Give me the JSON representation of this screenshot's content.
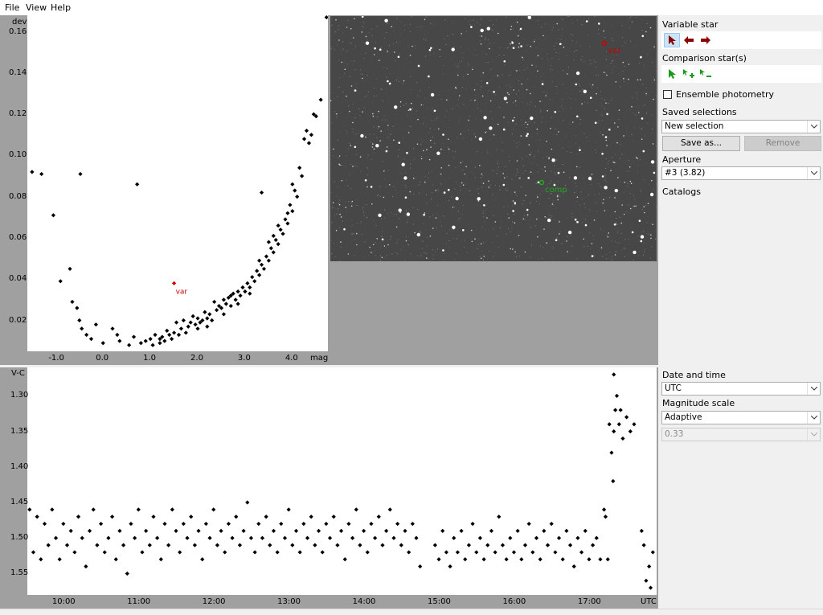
{
  "menu": {
    "file": "File",
    "view": "View",
    "help": "Help"
  },
  "scatter": {
    "ylabel": "dev",
    "xlabel": "mag",
    "yticks": [
      "0.16",
      "0.14",
      "0.12",
      "0.10",
      "0.08",
      "0.06",
      "0.04",
      "0.02"
    ],
    "xticks": [
      "-1.0",
      "0.0",
      "1.0",
      "2.0",
      "3.0",
      "4.0"
    ],
    "var_label": "var"
  },
  "image": {
    "var_label": "var",
    "comp_label": "comp"
  },
  "lightcurve": {
    "ylabel": "V-C",
    "xlabel": "UTC",
    "yticks": [
      "1.30",
      "1.35",
      "1.40",
      "1.45",
      "1.50",
      "1.55"
    ],
    "xticks": [
      "10:00",
      "11:00",
      "12:00",
      "13:00",
      "14:00",
      "15:00",
      "16:00",
      "17:00"
    ]
  },
  "sidebar_top": {
    "variable_star": "Variable star",
    "comparison_stars": "Comparison star(s)",
    "ensemble": "Ensemble photometry",
    "saved_selections": "Saved selections",
    "saved_value": "New selection",
    "save_as": "Save as...",
    "remove": "Remove",
    "aperture": "Aperture",
    "aperture_value": "#3 (3.82)",
    "catalogs": "Catalogs"
  },
  "sidebar_bottom": {
    "date_time": "Date and time",
    "date_time_value": "UTC",
    "mag_scale": "Magnitude scale",
    "mag_scale_value": "Adaptive",
    "scale_value": "0.33"
  },
  "colors": {
    "var": "#cc0000",
    "comp": "#22aa22",
    "arrow_red": "#8b0000",
    "arrow_green": "#1a9a1a"
  },
  "chart_data": [
    {
      "type": "scatter",
      "ylabel": "dev",
      "xlabel": "mag",
      "xlim": [
        -1.6,
        4.75
      ],
      "ylim": [
        0.005,
        0.168
      ],
      "highlight": {
        "name": "var",
        "x": 1.5,
        "y": 0.038
      },
      "points": [
        [
          -1.5,
          0.092
        ],
        [
          -1.3,
          0.091
        ],
        [
          -1.05,
          0.071
        ],
        [
          -0.9,
          0.039
        ],
        [
          -0.7,
          0.045
        ],
        [
          -0.65,
          0.029
        ],
        [
          -0.55,
          0.026
        ],
        [
          -0.5,
          0.02
        ],
        [
          -0.48,
          0.091
        ],
        [
          -0.45,
          0.016
        ],
        [
          -0.35,
          0.013
        ],
        [
          -0.25,
          0.011
        ],
        [
          -0.15,
          0.018
        ],
        [
          0.0,
          0.009
        ],
        [
          0.2,
          0.016
        ],
        [
          0.3,
          0.013
        ],
        [
          0.35,
          0.01
        ],
        [
          0.55,
          0.008
        ],
        [
          0.65,
          0.012
        ],
        [
          0.72,
          0.086
        ],
        [
          0.8,
          0.009
        ],
        [
          0.9,
          0.01
        ],
        [
          1.0,
          0.011
        ],
        [
          1.05,
          0.008
        ],
        [
          1.1,
          0.013
        ],
        [
          1.2,
          0.011
        ],
        [
          1.25,
          0.012
        ],
        [
          1.3,
          0.01
        ],
        [
          1.35,
          0.015
        ],
        [
          1.4,
          0.013
        ],
        [
          1.45,
          0.011
        ],
        [
          1.55,
          0.019
        ],
        [
          1.6,
          0.013
        ],
        [
          1.65,
          0.016
        ],
        [
          1.7,
          0.02
        ],
        [
          1.75,
          0.014
        ],
        [
          1.8,
          0.017
        ],
        [
          1.85,
          0.019
        ],
        [
          1.9,
          0.022
        ],
        [
          1.95,
          0.018
        ],
        [
          2.0,
          0.021
        ],
        [
          2.05,
          0.019
        ],
        [
          2.1,
          0.02
        ],
        [
          2.15,
          0.024
        ],
        [
          2.2,
          0.021
        ],
        [
          2.25,
          0.023
        ],
        [
          2.3,
          0.02
        ],
        [
          2.35,
          0.029
        ],
        [
          2.4,
          0.025
        ],
        [
          2.45,
          0.027
        ],
        [
          2.5,
          0.026
        ],
        [
          2.55,
          0.03
        ],
        [
          2.6,
          0.028
        ],
        [
          2.65,
          0.031
        ],
        [
          2.7,
          0.027
        ],
        [
          2.75,
          0.033
        ],
        [
          2.8,
          0.03
        ],
        [
          2.85,
          0.034
        ],
        [
          2.9,
          0.032
        ],
        [
          2.95,
          0.036
        ],
        [
          3.0,
          0.034
        ],
        [
          3.05,
          0.038
        ],
        [
          3.1,
          0.036
        ],
        [
          3.15,
          0.041
        ],
        [
          3.2,
          0.039
        ],
        [
          3.25,
          0.044
        ],
        [
          3.3,
          0.042
        ],
        [
          3.35,
          0.047
        ],
        [
          3.4,
          0.045
        ],
        [
          3.45,
          0.051
        ],
        [
          3.5,
          0.049
        ],
        [
          3.55,
          0.055
        ],
        [
          3.6,
          0.053
        ],
        [
          3.65,
          0.059
        ],
        [
          3.7,
          0.057
        ],
        [
          3.75,
          0.064
        ],
        [
          3.8,
          0.062
        ],
        [
          3.85,
          0.069
        ],
        [
          3.9,
          0.067
        ],
        [
          3.95,
          0.076
        ],
        [
          4.0,
          0.073
        ],
        [
          4.05,
          0.083
        ],
        [
          4.1,
          0.08
        ],
        [
          4.15,
          0.094
        ],
        [
          4.2,
          0.09
        ],
        [
          4.25,
          0.108
        ],
        [
          4.3,
          0.112
        ],
        [
          4.35,
          0.106
        ],
        [
          4.4,
          0.11
        ],
        [
          4.45,
          0.12
        ],
        [
          4.5,
          0.119
        ],
        [
          3.35,
          0.082
        ],
        [
          4.6,
          0.127
        ],
        [
          4.72,
          0.167
        ],
        [
          2.85,
          0.028
        ],
        [
          3.1,
          0.033
        ],
        [
          3.6,
          0.061
        ],
        [
          3.9,
          0.072
        ],
        [
          2.2,
          0.017
        ],
        [
          1.5,
          0.014
        ],
        [
          2.7,
          0.032
        ],
        [
          3.3,
          0.049
        ],
        [
          4.0,
          0.086
        ],
        [
          3.7,
          0.066
        ],
        [
          3.5,
          0.058
        ],
        [
          2.55,
          0.023
        ],
        [
          2.0,
          0.016
        ],
        [
          1.2,
          0.009
        ]
      ]
    },
    {
      "type": "scatter",
      "ylabel": "V-C",
      "xlabel": "UTC",
      "xlim_hours": [
        9.52,
        17.9
      ],
      "ylim": [
        1.58,
        1.26
      ],
      "points_hours": [
        [
          9.55,
          1.46
        ],
        [
          9.6,
          1.52
        ],
        [
          9.65,
          1.47
        ],
        [
          9.7,
          1.53
        ],
        [
          9.75,
          1.48
        ],
        [
          9.8,
          1.51
        ],
        [
          9.85,
          1.46
        ],
        [
          9.9,
          1.5
        ],
        [
          9.95,
          1.53
        ],
        [
          10.0,
          1.48
        ],
        [
          10.05,
          1.51
        ],
        [
          10.1,
          1.49
        ],
        [
          10.15,
          1.52
        ],
        [
          10.2,
          1.47
        ],
        [
          10.25,
          1.5
        ],
        [
          10.3,
          1.54
        ],
        [
          10.35,
          1.49
        ],
        [
          10.4,
          1.46
        ],
        [
          10.45,
          1.51
        ],
        [
          10.5,
          1.48
        ],
        [
          10.55,
          1.52
        ],
        [
          10.6,
          1.5
        ],
        [
          10.65,
          1.47
        ],
        [
          10.7,
          1.53
        ],
        [
          10.75,
          1.49
        ],
        [
          10.8,
          1.51
        ],
        [
          10.85,
          1.55
        ],
        [
          10.9,
          1.48
        ],
        [
          10.95,
          1.5
        ],
        [
          11.0,
          1.46
        ],
        [
          11.05,
          1.52
        ],
        [
          11.1,
          1.49
        ],
        [
          11.15,
          1.51
        ],
        [
          11.2,
          1.47
        ],
        [
          11.25,
          1.5
        ],
        [
          11.3,
          1.53
        ],
        [
          11.35,
          1.48
        ],
        [
          11.4,
          1.51
        ],
        [
          11.45,
          1.46
        ],
        [
          11.5,
          1.49
        ],
        [
          11.55,
          1.52
        ],
        [
          11.6,
          1.48
        ],
        [
          11.65,
          1.5
        ],
        [
          11.7,
          1.47
        ],
        [
          11.75,
          1.51
        ],
        [
          11.8,
          1.49
        ],
        [
          11.85,
          1.53
        ],
        [
          11.9,
          1.48
        ],
        [
          11.95,
          1.5
        ],
        [
          12.0,
          1.46
        ],
        [
          12.05,
          1.51
        ],
        [
          12.1,
          1.49
        ],
        [
          12.15,
          1.52
        ],
        [
          12.2,
          1.48
        ],
        [
          12.25,
          1.5
        ],
        [
          12.3,
          1.47
        ],
        [
          12.35,
          1.51
        ],
        [
          12.4,
          1.49
        ],
        [
          12.45,
          1.45
        ],
        [
          12.5,
          1.5
        ],
        [
          12.55,
          1.52
        ],
        [
          12.6,
          1.48
        ],
        [
          12.65,
          1.5
        ],
        [
          12.7,
          1.47
        ],
        [
          12.75,
          1.51
        ],
        [
          12.8,
          1.49
        ],
        [
          12.85,
          1.52
        ],
        [
          12.9,
          1.48
        ],
        [
          12.95,
          1.5
        ],
        [
          13.0,
          1.46
        ],
        [
          13.05,
          1.51
        ],
        [
          13.1,
          1.49
        ],
        [
          13.15,
          1.52
        ],
        [
          13.2,
          1.48
        ],
        [
          13.25,
          1.5
        ],
        [
          13.3,
          1.47
        ],
        [
          13.35,
          1.51
        ],
        [
          13.4,
          1.49
        ],
        [
          13.45,
          1.52
        ],
        [
          13.5,
          1.48
        ],
        [
          13.55,
          1.5
        ],
        [
          13.6,
          1.47
        ],
        [
          13.65,
          1.51
        ],
        [
          13.7,
          1.49
        ],
        [
          13.75,
          1.53
        ],
        [
          13.8,
          1.48
        ],
        [
          13.85,
          1.5
        ],
        [
          13.9,
          1.46
        ],
        [
          13.95,
          1.51
        ],
        [
          14.0,
          1.49
        ],
        [
          14.05,
          1.52
        ],
        [
          14.1,
          1.48
        ],
        [
          14.15,
          1.5
        ],
        [
          14.2,
          1.47
        ],
        [
          14.25,
          1.51
        ],
        [
          14.3,
          1.49
        ],
        [
          14.35,
          1.46
        ],
        [
          14.4,
          1.5
        ],
        [
          14.45,
          1.48
        ],
        [
          14.5,
          1.51
        ],
        [
          14.55,
          1.49
        ],
        [
          14.6,
          1.52
        ],
        [
          14.65,
          1.48
        ],
        [
          14.7,
          1.5
        ],
        [
          14.75,
          1.54
        ],
        [
          14.95,
          1.51
        ],
        [
          15.0,
          1.53
        ],
        [
          15.05,
          1.49
        ],
        [
          15.1,
          1.52
        ],
        [
          15.15,
          1.54
        ],
        [
          15.2,
          1.5
        ],
        [
          15.25,
          1.52
        ],
        [
          15.3,
          1.49
        ],
        [
          15.35,
          1.53
        ],
        [
          15.4,
          1.51
        ],
        [
          15.45,
          1.48
        ],
        [
          15.5,
          1.52
        ],
        [
          15.55,
          1.5
        ],
        [
          15.6,
          1.53
        ],
        [
          15.65,
          1.51
        ],
        [
          15.7,
          1.49
        ],
        [
          15.75,
          1.52
        ],
        [
          15.8,
          1.47
        ],
        [
          15.85,
          1.51
        ],
        [
          15.9,
          1.53
        ],
        [
          15.95,
          1.5
        ],
        [
          16.0,
          1.52
        ],
        [
          16.05,
          1.49
        ],
        [
          16.1,
          1.53
        ],
        [
          16.15,
          1.51
        ],
        [
          16.2,
          1.48
        ],
        [
          16.25,
          1.52
        ],
        [
          16.3,
          1.5
        ],
        [
          16.35,
          1.53
        ],
        [
          16.4,
          1.49
        ],
        [
          16.45,
          1.51
        ],
        [
          16.5,
          1.48
        ],
        [
          16.55,
          1.52
        ],
        [
          16.6,
          1.5
        ],
        [
          16.65,
          1.53
        ],
        [
          16.7,
          1.49
        ],
        [
          16.75,
          1.51
        ],
        [
          16.8,
          1.54
        ],
        [
          16.85,
          1.5
        ],
        [
          16.9,
          1.52
        ],
        [
          16.95,
          1.49
        ],
        [
          17.0,
          1.53
        ],
        [
          17.05,
          1.51
        ],
        [
          17.1,
          1.5
        ],
        [
          17.15,
          1.53
        ],
        [
          17.2,
          1.46
        ],
        [
          17.22,
          1.47
        ],
        [
          17.25,
          1.53
        ],
        [
          17.27,
          1.34
        ],
        [
          17.3,
          1.38
        ],
        [
          17.32,
          1.42
        ],
        [
          17.33,
          1.35
        ],
        [
          17.35,
          1.32
        ],
        [
          17.37,
          1.3
        ],
        [
          17.4,
          1.34
        ],
        [
          17.42,
          1.32
        ],
        [
          17.45,
          1.36
        ],
        [
          17.5,
          1.33
        ],
        [
          17.55,
          1.35
        ],
        [
          17.6,
          1.34
        ],
        [
          17.33,
          1.27
        ],
        [
          17.7,
          1.49
        ],
        [
          17.73,
          1.51
        ],
        [
          17.76,
          1.56
        ],
        [
          17.8,
          1.54
        ],
        [
          17.82,
          1.57
        ],
        [
          17.85,
          1.52
        ]
      ]
    }
  ]
}
